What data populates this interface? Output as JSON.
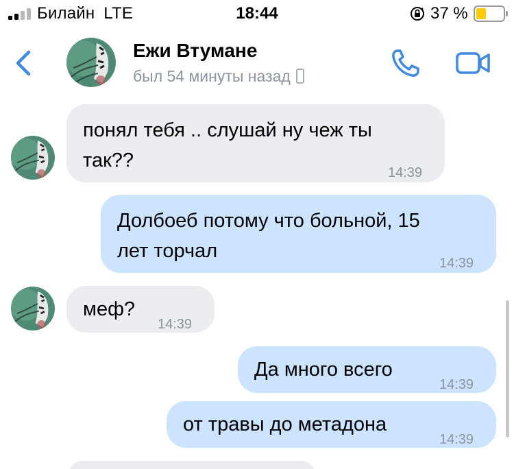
{
  "status_bar": {
    "carrier": "Билайн",
    "network": "LTE",
    "time": "18:44",
    "battery_percent": "37 %",
    "battery_level": 0.37,
    "battery_color": "#ffcc00",
    "icons": [
      "signal-icon",
      "orientation-lock-icon",
      "battery-icon"
    ]
  },
  "header": {
    "contact_name": "Ежи Втумане",
    "last_seen": "был 54 минуты назад",
    "accent_color": "#3f8ae0",
    "icons": [
      "back-icon",
      "avatar",
      "mobile-device-icon",
      "call-icon",
      "video-call-icon"
    ]
  },
  "messages": [
    {
      "direction": "incoming",
      "lines": [
        "понял тебя .. слушай ну чеж ты",
        "так??"
      ],
      "time": "14:39"
    },
    {
      "direction": "outgoing",
      "lines": [
        "Долбоеб потому что больной, 15",
        "лет торчал"
      ],
      "time": "14:39"
    },
    {
      "direction": "incoming",
      "lines": [
        "меф?"
      ],
      "time": "14:39"
    },
    {
      "direction": "outgoing",
      "lines": [
        "Да много всего"
      ],
      "time": "14:39"
    },
    {
      "direction": "outgoing",
      "lines": [
        "от травы до метадона"
      ],
      "time": "14:39"
    }
  ],
  "colors": {
    "incoming_bubble": "#ebedf0",
    "outgoing_bubble": "#cce4ff",
    "secondary_text": "#8b939d"
  }
}
